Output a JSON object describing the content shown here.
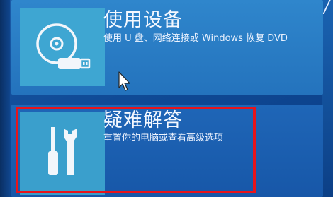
{
  "options": [
    {
      "title": "使用设备",
      "description": "使用 U 盘、网络连接或 Windows 恢复 DVD",
      "icon": "disc-usb-icon"
    },
    {
      "title": "疑难解答",
      "description": "重置你的电脑或查看高级选项",
      "icon": "screwdriver-wrench-icon"
    }
  ],
  "highlight": {
    "target": "troubleshoot-tile",
    "color": "#e8141b"
  },
  "colors": {
    "background": "#0f4a96",
    "tile_device": "#2a7cc4",
    "tile_troubleshoot": "#1b5fb0",
    "icon_box": "#3ea6d2",
    "text": "#f4f8ff"
  }
}
